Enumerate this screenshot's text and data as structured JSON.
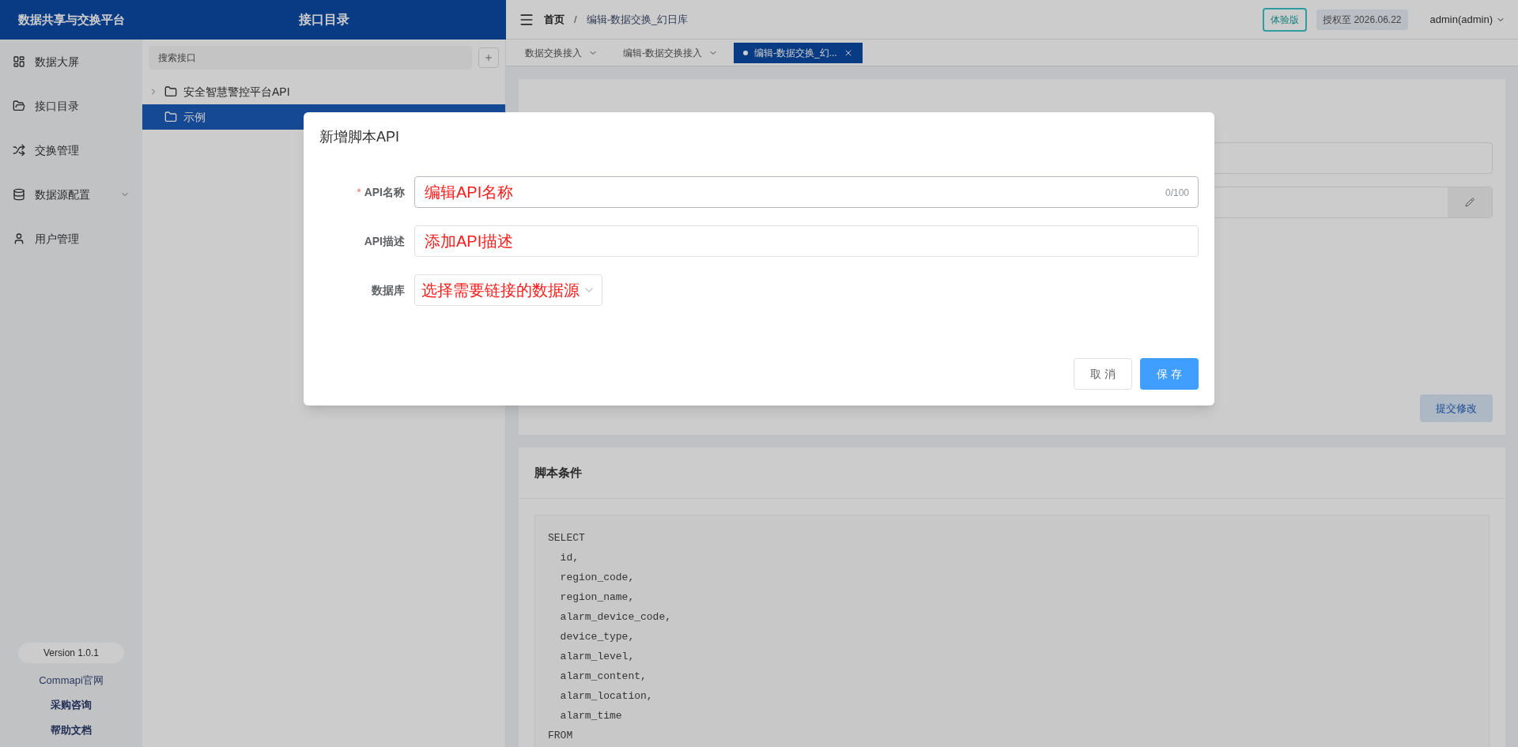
{
  "header": {
    "app_title": "数据共享与交换平台",
    "section_title": "接口目录"
  },
  "sidebar": {
    "items": [
      {
        "label": "数据大屏",
        "kind": "screen",
        "expandable": false
      },
      {
        "label": "接口目录",
        "kind": "folder",
        "expandable": false
      },
      {
        "label": "交换管理",
        "kind": "exchange",
        "expandable": false
      },
      {
        "label": "数据源配置",
        "kind": "database",
        "expandable": true
      },
      {
        "label": "用户管理",
        "kind": "user",
        "expandable": false
      }
    ],
    "version": "Version 1.0.1",
    "links": [
      "Commapi官网",
      "采购咨询",
      "帮助文档"
    ]
  },
  "tree": {
    "search": {
      "placeholder": "搜索接口"
    },
    "items": [
      {
        "label": "安全智慧警控平台API",
        "selected": false,
        "expandable": true
      },
      {
        "label": "示例",
        "selected": true,
        "expandable": false
      }
    ]
  },
  "topbar": {
    "breadcrumb": [
      "首页",
      "编辑-数据交换_幻日库"
    ],
    "breadcrumb_separator": "/",
    "badge": "体验版",
    "license": "授权至 2026.06.22",
    "user": "admin(admin)"
  },
  "tabs": [
    {
      "label": "数据交换接入",
      "selected": false
    },
    {
      "label": "编辑-数据交换接入",
      "selected": false
    },
    {
      "label": "编辑-数据交换_幻...",
      "selected": true
    }
  ],
  "basic_card": {
    "submit_button": "提交修改"
  },
  "script_card": {
    "title": "脚本条件",
    "code_lines": [
      "SELECT",
      "  id,",
      "  region_code,",
      "  region_name,",
      "  alarm_device_code,",
      "  device_type,",
      "  alarm_level,",
      "  alarm_content,",
      "  alarm_location,",
      "  alarm_time",
      "FROM"
    ]
  },
  "dialog": {
    "title": "新增脚本API",
    "required_mark": "*",
    "fields": [
      {
        "kind": "text",
        "label": "API名称",
        "required": true,
        "placeholder": "编辑API名称",
        "counter": "0/100",
        "focused": true
      },
      {
        "kind": "text",
        "label": "API描述",
        "required": false,
        "placeholder": "添加API描述",
        "focused": false
      },
      {
        "kind": "select",
        "label": "数据库",
        "required": false,
        "placeholder": "选择需要链接的数据源",
        "focused": false
      }
    ],
    "buttons": [
      {
        "label": "取 消",
        "kind": "secondary"
      },
      {
        "label": "保 存",
        "kind": "primary"
      }
    ]
  }
}
